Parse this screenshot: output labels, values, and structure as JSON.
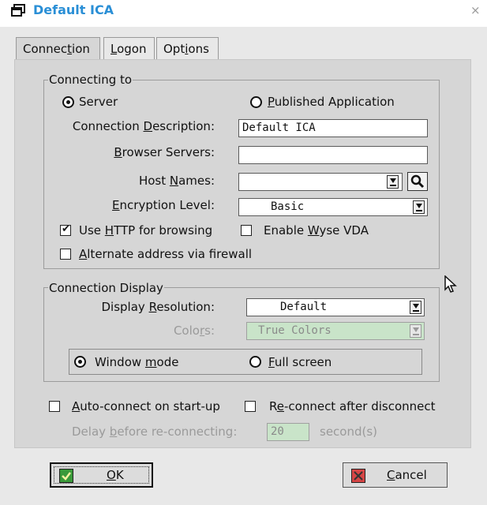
{
  "window": {
    "title": "Default ICA",
    "close_glyph": "×"
  },
  "tabs": [
    {
      "label_pre": "Connec",
      "label_u": "t",
      "label_post": "ion",
      "active": true
    },
    {
      "label_pre": "",
      "label_u": "L",
      "label_post": "ogon",
      "active": false
    },
    {
      "label_pre": "Opt",
      "label_u": "i",
      "label_post": "ons",
      "active": false
    }
  ],
  "connecting_to": {
    "legend": "Connecting to",
    "radio_server": {
      "pre": "",
      "u": "",
      "post": "Server",
      "selected": true
    },
    "radio_published": {
      "pre": "",
      "u": "P",
      "post": "ublished Application",
      "selected": false
    },
    "description": {
      "label_pre": "Connection ",
      "label_u": "D",
      "label_post": "escription:",
      "value": "Default ICA"
    },
    "browser_servers": {
      "label_pre": "",
      "label_u": "B",
      "label_post": "rowser Servers:",
      "value": ""
    },
    "host_names": {
      "label_pre": "Host ",
      "label_u": "N",
      "label_post": "ames:",
      "value": ""
    },
    "encryption": {
      "label_pre": "",
      "label_u": "E",
      "label_post": "ncryption Level:",
      "value": "Basic"
    },
    "use_http": {
      "pre": "Use ",
      "u": "H",
      "post": "TTP for browsing",
      "checked": true
    },
    "enable_wyse": {
      "pre": "Enable ",
      "u": "W",
      "post": "yse VDA",
      "checked": false
    },
    "alternate": {
      "pre": "",
      "u": "A",
      "post": "lternate address via firewall",
      "checked": false
    }
  },
  "connection_display": {
    "legend": "Connection Display",
    "resolution": {
      "label_pre": "Display ",
      "label_u": "R",
      "label_post": "esolution:",
      "value": "Default"
    },
    "colors": {
      "label_pre": "Colo",
      "label_u": "r",
      "label_post": "s:",
      "value": "True Colors",
      "disabled": true
    },
    "window_mode": {
      "pre": "Window ",
      "u": "m",
      "post": "ode",
      "selected": true
    },
    "full_screen": {
      "pre": "",
      "u": "F",
      "post": "ull screen",
      "selected": false
    }
  },
  "options": {
    "auto_connect": {
      "pre": "",
      "u": "A",
      "post": "uto-connect on start-up",
      "checked": false
    },
    "reconnect": {
      "pre": "R",
      "u": "e",
      "post": "-connect after disconnect",
      "checked": false
    },
    "delay": {
      "label_pre": "Delay ",
      "label_u": "b",
      "label_post": "efore re-connecting:",
      "value": "20",
      "unit": "second(s)"
    }
  },
  "buttons": {
    "ok": {
      "pre": "",
      "u": "O",
      "post": "K"
    },
    "cancel": {
      "pre": "",
      "u": "C",
      "post": "ancel"
    }
  },
  "colors": {
    "title": "#2a8fd6",
    "panel": "#d6d6d6",
    "ok_icon": "#3a9a3a",
    "cancel_icon": "#d64545",
    "disabled_field": "#c9e4c9"
  },
  "icons": [
    "window-icon",
    "search-icon",
    "ok-check-icon",
    "cancel-x-icon"
  ]
}
